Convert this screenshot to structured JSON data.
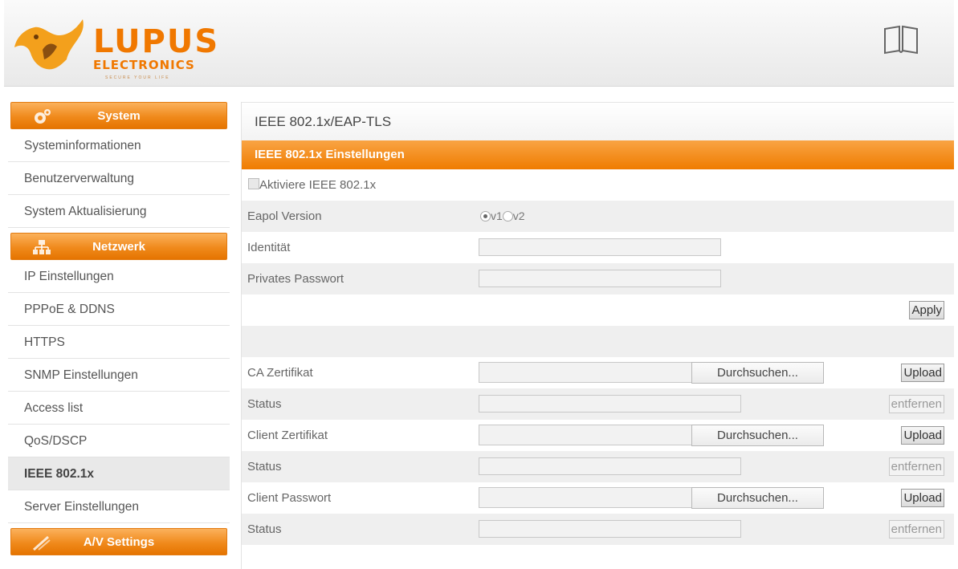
{
  "header": {
    "logo_main": "LUPUS",
    "logo_sub": "ELECTRONICS",
    "logo_tagline": "SECURE YOUR LIFE"
  },
  "sidebar": {
    "sections": [
      {
        "title": "System",
        "icon": "gear-icon",
        "items": [
          "Systeminformationen",
          "Benutzerverwaltung",
          "System Aktualisierung"
        ]
      },
      {
        "title": "Netzwerk",
        "icon": "network-icon",
        "items": [
          "IP Einstellungen",
          "PPPoE & DDNS",
          "HTTPS",
          "SNMP Einstellungen",
          "Access list",
          "QoS/DSCP",
          "IEEE 802.1x",
          "Server Einstellungen"
        ]
      },
      {
        "title": "A/V Settings",
        "icon": "av-settings-icon",
        "items": []
      }
    ],
    "active_item": "IEEE 802.1x"
  },
  "main": {
    "title": "IEEE 802.1x/EAP-TLS",
    "section_title": "IEEE 802.1x Einstellungen",
    "enable_label": "Aktiviere IEEE 802.1x",
    "enable_checked": false,
    "eapol_label": "Eapol Version",
    "eapol_options": [
      "v1",
      "v2"
    ],
    "eapol_selected": "v1",
    "identity_label": "Identität",
    "identity_value": "",
    "private_password_label": "Privates Passwort",
    "private_password_value": "",
    "apply_label": "Apply",
    "certificates": [
      {
        "label": "CA Zertifikat",
        "browse": "Durchsuchen...",
        "upload": "Upload",
        "status_label": "Status",
        "status_value": "",
        "remove": "entfernen"
      },
      {
        "label": "Client Zertifikat",
        "browse": "Durchsuchen...",
        "upload": "Upload",
        "status_label": "Status",
        "status_value": "",
        "remove": "entfernen"
      },
      {
        "label": "Client Passwort",
        "browse": "Durchsuchen...",
        "upload": "Upload",
        "status_label": "Status",
        "status_value": "",
        "remove": "entfernen"
      }
    ]
  },
  "colors": {
    "accent": "#ef7c00",
    "active_item_bg": "#e9e9e9",
    "row_alt": "#efefef"
  }
}
